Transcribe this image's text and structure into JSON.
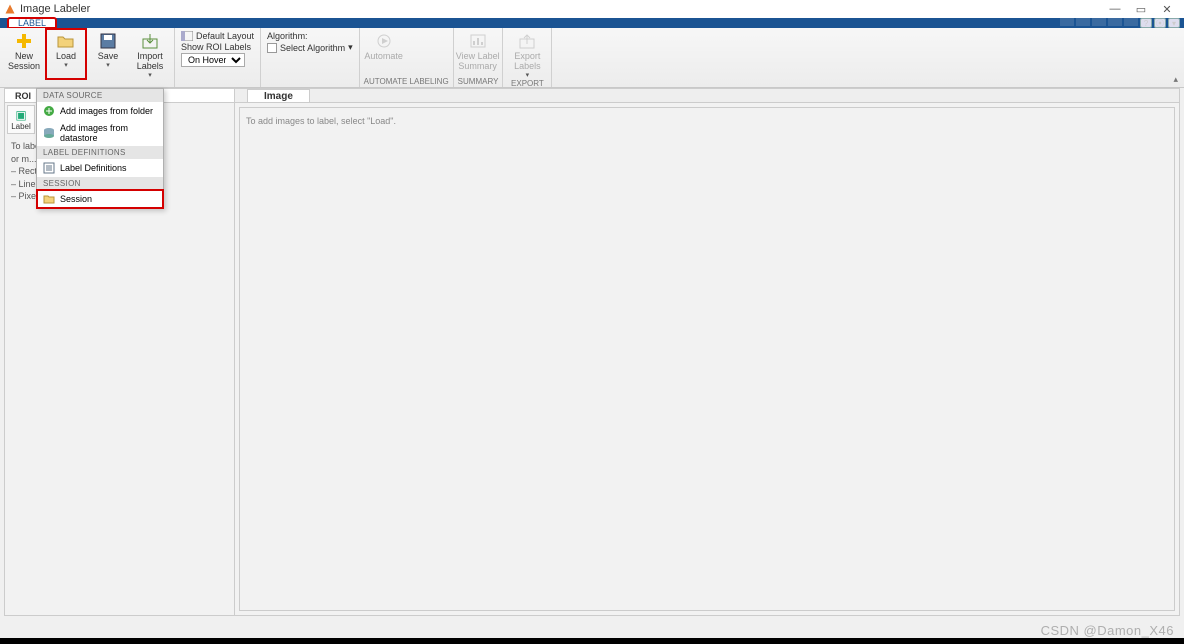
{
  "window": {
    "title": "Image Labeler",
    "min": "—",
    "max": "▭",
    "close": "✕"
  },
  "tabs": {
    "main": "LABEL"
  },
  "ribbon": {
    "new": "New\nSession",
    "load": "Load",
    "save": "Save",
    "import": "Import\nLabels",
    "layout_default": "Default Layout",
    "layout_show_roi": "Show ROI Labels",
    "layout_onhover": "On Hover",
    "algo_label": "Algorithm:",
    "algo_select": "Select Algorithm",
    "automate": "Automate",
    "view_summary": "View Label\nSummary",
    "export": "Export\nLabels",
    "group_automate": "AUTOMATE LABELING",
    "group_summary": "SUMMARY",
    "group_export": "EXPORT",
    "arrow": "▾"
  },
  "dropdown": {
    "h1": "DATA SOURCE",
    "i1": "Add images from folder",
    "i2": "Add images from datastore",
    "h2": "LABEL DEFINITIONS",
    "i3": "Label Definitions",
    "h3": "SESSION",
    "i4": "Session"
  },
  "leftpanel": {
    "tab": "ROI",
    "labelbtn": "Label",
    "hint": "To label...\nor m...",
    "lines": [
      "– Rect...",
      "– Line Label",
      "– Pixel label"
    ]
  },
  "canvas": {
    "tab": "Image",
    "hint": "To add images to label, select \"Load\"."
  },
  "watermark": "CSDN @Damon_X46"
}
